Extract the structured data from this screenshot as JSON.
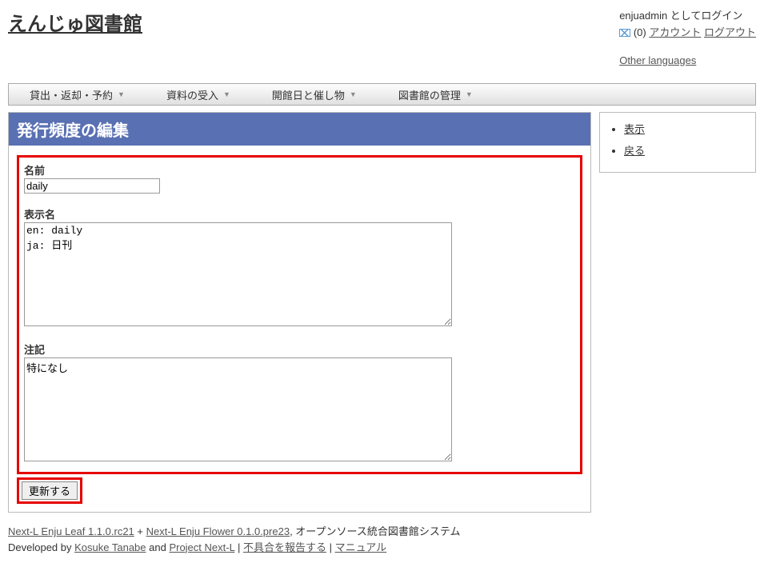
{
  "header": {
    "site_title": "えんじゅ図書館",
    "login_status": "enjuadmin としてログイン",
    "mail_count": "(0)",
    "account_link": "アカウント",
    "logout_link": "ログアウト",
    "other_languages": "Other languages"
  },
  "menubar": {
    "items": [
      "貸出・返却・予約",
      "資料の受入",
      "開館日と催し物",
      "図書館の管理"
    ]
  },
  "panel": {
    "title": "発行頻度の編集"
  },
  "form": {
    "name_label": "名前",
    "name_value": "daily",
    "display_label": "表示名",
    "display_value": "en: daily\nja: 日刊",
    "note_label": "注記",
    "note_value": "特になし",
    "submit_label": "更新する"
  },
  "sidebar": {
    "items": [
      {
        "label": "表示"
      },
      {
        "label": "戻る"
      }
    ]
  },
  "footer": {
    "leaf_link": "Next-L Enju Leaf 1.1.0.rc21",
    "plus": " + ",
    "flower_link": "Next-L Enju Flower 0.1.0.pre23",
    "suffix": ", オープンソース統合図書館システム",
    "developed_by": "Developed by ",
    "developer_link": "Kosuke Tanabe",
    "and": " and ",
    "project_link": "Project Next-L",
    "sep": " | ",
    "report_link": "不具合を報告する",
    "manual_link": "マニュアル"
  }
}
